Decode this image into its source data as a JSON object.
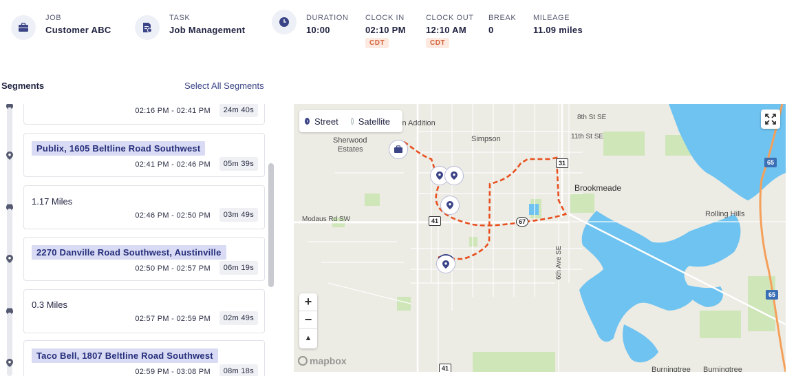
{
  "header": {
    "job": {
      "label": "JOB",
      "value": "Customer ABC",
      "icon": "briefcase-icon"
    },
    "task": {
      "label": "TASK",
      "value": "Job Management",
      "icon": "task-list-icon"
    },
    "duration": {
      "label": "DURATION",
      "value": "10:00",
      "icon": "clock-icon"
    },
    "clock_in": {
      "label": "CLOCK IN",
      "value": "02:10 PM",
      "tz": "CDT"
    },
    "clock_out": {
      "label": "CLOCK OUT",
      "value": "12:10 AM",
      "tz": "CDT"
    },
    "break": {
      "label": "BREAK",
      "value": "0"
    },
    "mileage": {
      "label": "MILEAGE",
      "value": "11.09 miles"
    }
  },
  "segments": {
    "title": "Segments",
    "select_all": "Select All Segments",
    "items": [
      {
        "type": "drive",
        "times": "02:16 PM - 02:41 PM",
        "duration": "24m 40s"
      },
      {
        "type": "stop",
        "location": "Publix, 1605 Beltline Road Southwest",
        "times": "02:41 PM - 02:46 PM",
        "duration": "05m 39s"
      },
      {
        "type": "drive",
        "miles": "1.17 Miles",
        "times": "02:46 PM - 02:50 PM",
        "duration": "03m 49s"
      },
      {
        "type": "stop",
        "location": "2270 Danville Road Southwest, Austinville",
        "times": "02:50 PM - 02:57 PM",
        "duration": "06m 19s"
      },
      {
        "type": "drive",
        "miles": "0.3 Miles",
        "times": "02:57 PM - 02:59 PM",
        "duration": "02m 49s"
      },
      {
        "type": "stop",
        "location": "Taco Bell, 1807 Beltline Road Southwest",
        "times": "02:59 PM - 03:08 PM",
        "duration": "08m 18s"
      }
    ]
  },
  "map": {
    "view_options": [
      "Street",
      "Satellite"
    ],
    "selected_view": "Street",
    "zoom_in": "+",
    "zoom_out": "−",
    "compass": "▲",
    "attribution": "mapbox",
    "route_color": "#e8501f",
    "water_color": "#6fc3f0",
    "labels": {
      "griffin": "riffin Addition",
      "sherwood": "Sherwood",
      "estates": "Estates",
      "simpson": "Simpson",
      "eighth_st": "8th St SE",
      "eleventh_st": "11th St SE",
      "brookmeade": "Brookmeade",
      "rolling_hills": "Rolling Hills",
      "modaus": "Modaus Rd SW",
      "sixth_ave": "6th Ave SE",
      "burningtree1": "Burningtree",
      "burningtree2": "Burningtree"
    },
    "shields": {
      "r31": "31",
      "r67": "67",
      "r41": "41",
      "r41b": "41",
      "i65a": "65",
      "i65b": "65"
    }
  }
}
